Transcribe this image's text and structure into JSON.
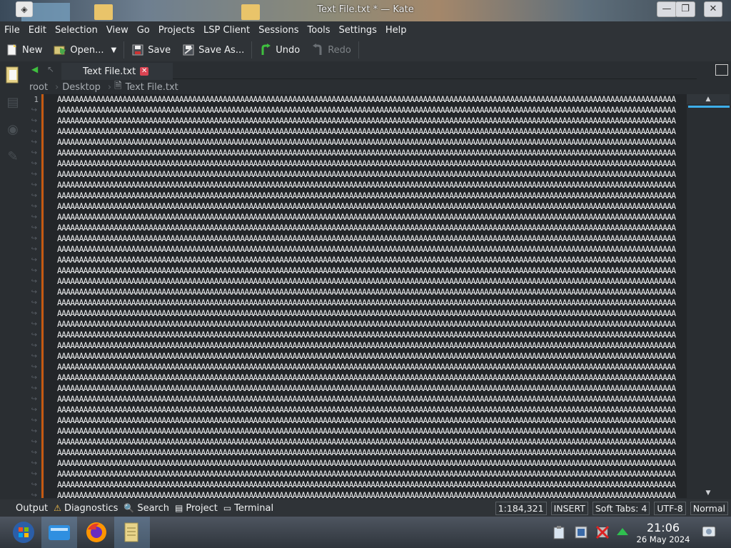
{
  "window": {
    "title": "Text File.txt * — Kate",
    "minimize": "—",
    "maximize": "❐",
    "close": "✕"
  },
  "menu": [
    "File",
    "Edit",
    "Selection",
    "View",
    "Go",
    "Projects",
    "LSP Client",
    "Sessions",
    "Tools",
    "Settings",
    "Help"
  ],
  "toolbar": {
    "new": "New",
    "open": "Open...",
    "save": "Save",
    "save_as": "Save As...",
    "undo": "Undo",
    "redo": "Redo"
  },
  "tabs": [
    {
      "label": "Text File.txt",
      "modified": true
    }
  ],
  "breadcrumb": [
    "root",
    "Desktop",
    "Text File.txt"
  ],
  "editor": {
    "first_line_number": "1",
    "wrap_marker": "↪",
    "line_text": "AAAAAAAAAAAAAAAAAAAAAAAAAAAAAAAAAAAAAAAAAAAAAAAAAAAAAAAAAAAAAAAAAAAAAAAAAAAAAAAAAAAAAAAAAAAAAAAAAAAAAAAAAAAAAAAAAAAAAAAAAAAAAAAAAAAAAAAAAAAAAA",
    "visible_lines": 38
  },
  "status": {
    "tabs": [
      {
        "label": "Output",
        "icon": "output-icon"
      },
      {
        "label": "Diagnostics",
        "icon": "warning-icon"
      },
      {
        "label": "Search",
        "icon": "search-icon"
      },
      {
        "label": "Project",
        "icon": "project-icon"
      },
      {
        "label": "Terminal",
        "icon": "terminal-icon"
      }
    ],
    "cursor": "1:184,321",
    "mode": "INSERT",
    "indent": "Soft Tabs: 4",
    "encoding": "UTF-8",
    "input_mode": "Normal"
  },
  "taskbar": {
    "time": "21:06",
    "date": "26 May 2024",
    "apps": [
      "start-menu-icon",
      "file-manager-icon",
      "firefox-icon",
      "kate-icon"
    ]
  }
}
